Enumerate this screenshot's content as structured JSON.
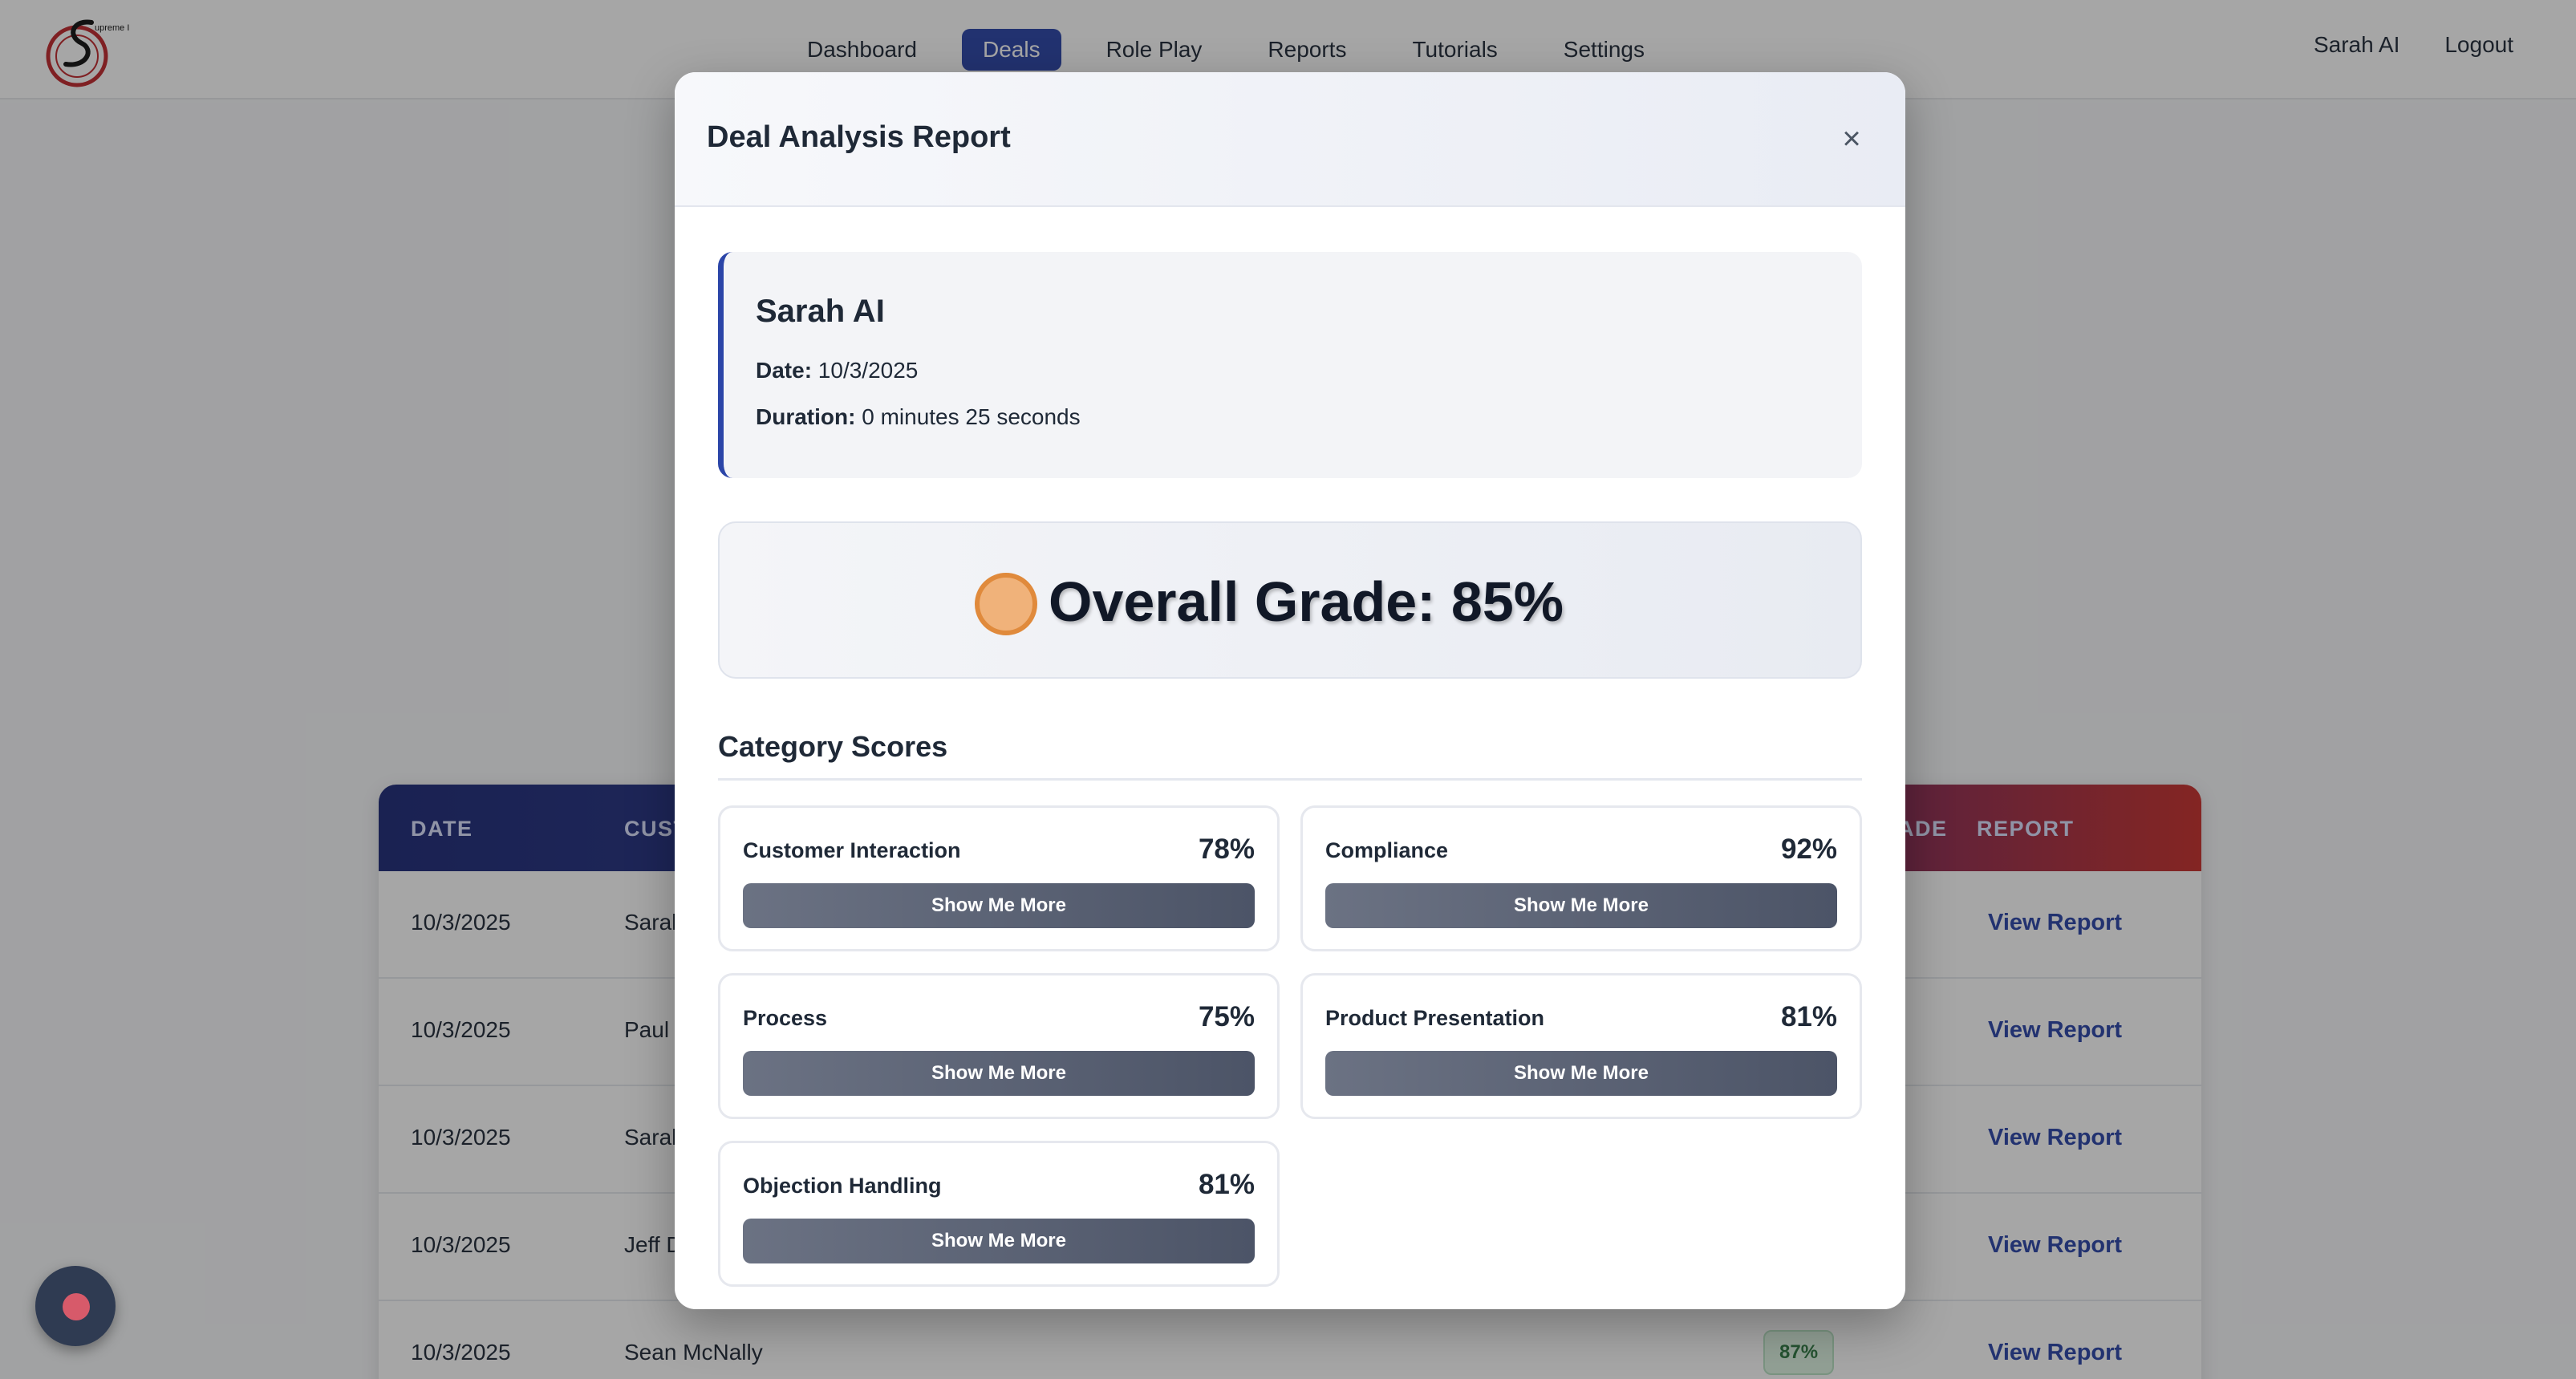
{
  "nav": {
    "logo_text": "upreme Inc",
    "items": [
      {
        "label": "Dashboard"
      },
      {
        "label": "Deals"
      },
      {
        "label": "Role Play"
      },
      {
        "label": "Reports"
      },
      {
        "label": "Tutorials"
      },
      {
        "label": "Settings"
      }
    ],
    "active": "Deals",
    "user_name": "Sarah AI",
    "logout_label": "Logout"
  },
  "table": {
    "headers": {
      "date": "DATE",
      "customer": "CUST",
      "grade": "ADE",
      "report": "REPORT"
    },
    "rows": [
      {
        "date": "10/3/2025",
        "customer": "Sarah",
        "report": "View Report"
      },
      {
        "date": "10/3/2025",
        "customer": "Paul S",
        "report": "View Report"
      },
      {
        "date": "10/3/2025",
        "customer": "Sarah",
        "report": "View Report"
      },
      {
        "date": "10/3/2025",
        "customer": "Jeff D",
        "report": "View Report"
      },
      {
        "date": "10/3/2025",
        "customer": "Sean McNally",
        "grade": "87%",
        "report": "View Report"
      }
    ]
  },
  "modal": {
    "title": "Deal Analysis Report",
    "close_label": "×",
    "info": {
      "name": "Sarah AI",
      "date_label": "Date:",
      "date_value": "10/3/2025",
      "duration_label": "Duration:",
      "duration_value": "0 minutes 25 seconds"
    },
    "overall_grade": "Overall Grade: 85%",
    "grade_color": "#e08a3c",
    "section_title": "Category Scores",
    "categories": [
      {
        "label": "Customer Interaction",
        "score": "78%",
        "button": "Show Me More"
      },
      {
        "label": "Compliance",
        "score": "92%",
        "button": "Show Me More"
      },
      {
        "label": "Process",
        "score": "75%",
        "button": "Show Me More"
      },
      {
        "label": "Product Presentation",
        "score": "81%",
        "button": "Show Me More"
      },
      {
        "label": "Objection Handling",
        "score": "81%",
        "button": "Show Me More"
      }
    ]
  },
  "colors": {
    "accent": "#2b45a8",
    "header_gradient_start": "#1e2a78",
    "header_gradient_end": "#c8302c"
  }
}
